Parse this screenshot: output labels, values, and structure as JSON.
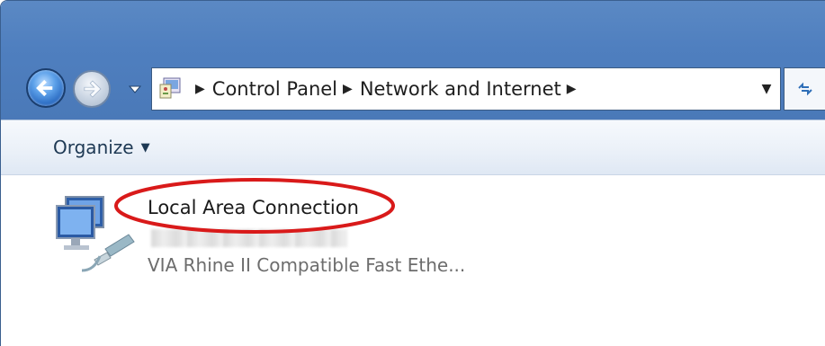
{
  "address_bar": {
    "breadcrumbs": [
      "Control Panel",
      "Network and Internet"
    ]
  },
  "toolbar": {
    "organize_label": "Organize"
  },
  "connections": [
    {
      "name": "Local Area Connection",
      "device": "VIA Rhine II Compatible Fast Ethe..."
    }
  ],
  "colors": {
    "title_bar": "#4f7fbf",
    "toolbar": "#eaf0f8",
    "annotation_circle": "#d91a1a"
  },
  "icons": {
    "back": "back-arrow-icon",
    "forward": "forward-arrow-icon",
    "recent": "chevron-down-icon",
    "location": "control-panel-icon",
    "refresh": "refresh-icon",
    "network": "network-adapter-icon"
  }
}
